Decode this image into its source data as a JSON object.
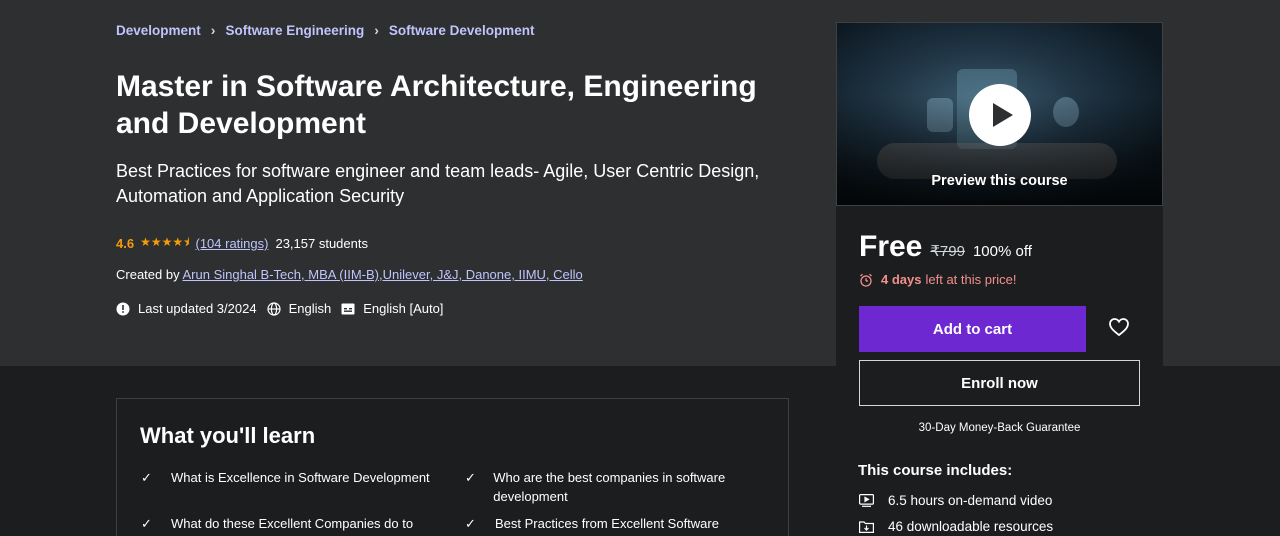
{
  "breadcrumb": [
    "Development",
    "Software Engineering",
    "Software Development"
  ],
  "course": {
    "title": "Master in Software Architecture, Engineering and Development",
    "subtitle": "Best Practices for software engineer and team leads- Agile, User Centric Design, Automation and Application Security",
    "rating": "4.6",
    "stars": "★★★★⯨",
    "ratings_link": "(104 ratings)",
    "students": "23,157 students",
    "created_by_label": "Created by",
    "instructor": "Arun Singhal B-Tech, MBA (IIM-B),Unilever, J&J, Danone, IIMU, Cello",
    "last_updated": "Last updated 3/2024",
    "language": "English",
    "captions": "English [Auto]"
  },
  "sidebar": {
    "preview_caption": "Preview this course",
    "price": "Free",
    "original_price": "₹799",
    "discount": "100% off",
    "timer_bold": "4 days",
    "timer_rest": "left at this price!",
    "add_to_cart": "Add to cart",
    "enroll_now": "Enroll now",
    "guarantee": "30-Day Money-Back Guarantee",
    "includes_title": "This course includes:",
    "includes": [
      "6.5 hours on-demand video",
      "46 downloadable resources"
    ]
  },
  "learn": {
    "title": "What you'll learn",
    "items": [
      "What is Excellence in Software Development",
      "Who are the best companies in software development",
      "What do these Excellent Companies do to",
      "Best Practices from Excellent Software"
    ]
  },
  "colors": {
    "accent_purple": "#6d28d2",
    "link": "#c0c4fc",
    "star": "#f69c08",
    "timer": "#f3908c"
  }
}
